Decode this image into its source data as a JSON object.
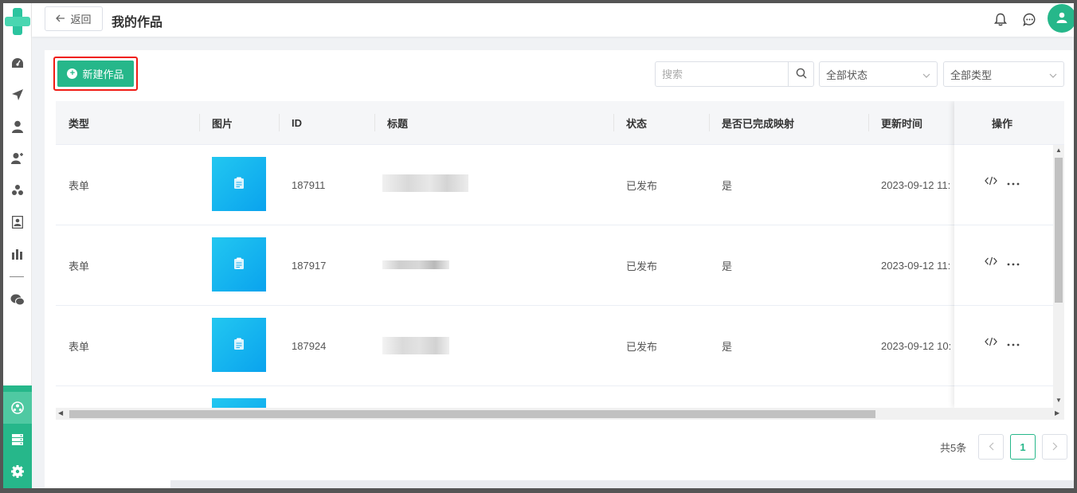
{
  "header": {
    "back_label": "返回",
    "title": "我的作品"
  },
  "toolbar": {
    "new_label": "新建作品",
    "search_placeholder": "搜索",
    "status_select": "全部状态",
    "type_select": "全部类型"
  },
  "table": {
    "columns": [
      "类型",
      "图片",
      "ID",
      "标题",
      "状态",
      "是否已完成映射",
      "更新时间",
      "操作"
    ],
    "rows": [
      {
        "type": "表单",
        "id": "187911",
        "status": "已发布",
        "mapped": "是",
        "updated": "2023-09-12 11:"
      },
      {
        "type": "表单",
        "id": "187917",
        "status": "已发布",
        "mapped": "是",
        "updated": "2023-09-12 11:"
      },
      {
        "type": "表单",
        "id": "187924",
        "status": "已发布",
        "mapped": "是",
        "updated": "2023-09-12 10:"
      }
    ]
  },
  "pagination": {
    "total": "共5条",
    "current_page": "1"
  },
  "colors": {
    "accent": "#26b78a",
    "highlight_border": "#f01c14",
    "thumbnail": "#0aa3ee"
  },
  "icons": {
    "sidebar": [
      "dashboard-icon",
      "send-icon",
      "user-icon",
      "users-icon",
      "group-icon",
      "contact-card-icon",
      "bar-chart-icon",
      "wechat-icon"
    ],
    "sidebar_bottom": [
      "network-icon",
      "server-icon",
      "settings-icon"
    ],
    "header": [
      "bell-icon",
      "chat-icon",
      "avatar-user-icon"
    ]
  }
}
